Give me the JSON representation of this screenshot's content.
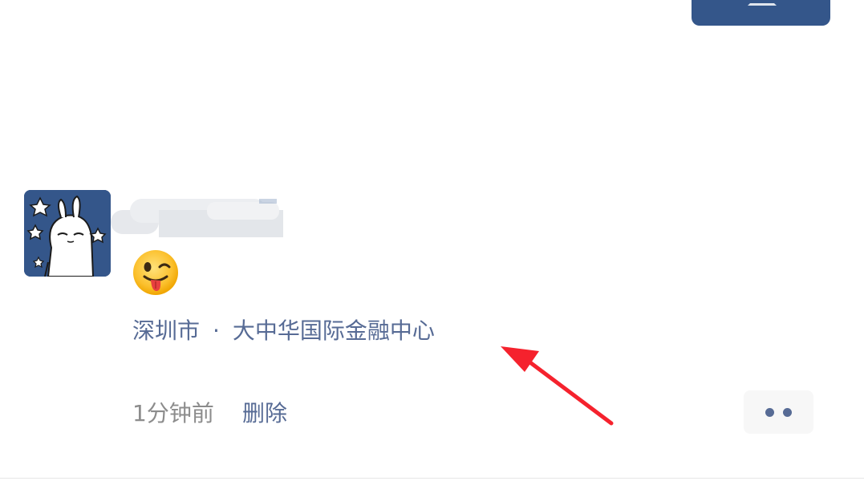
{
  "post": {
    "avatar_icon": "rabbit-avatar",
    "emoji_icon": "winking-tongue-emoji",
    "location": {
      "city": "深圳市",
      "separator": "·",
      "place": "大中华国际金融中心"
    },
    "time_text": "1分钟前",
    "delete_label": "删除",
    "more_icon": "two-dots-icon"
  },
  "annotation": {
    "icon": "red-arrow",
    "color": "#f5222d"
  },
  "colors": {
    "link": "#576b95",
    "muted": "#8c8c8c",
    "tile": "#34568a"
  }
}
